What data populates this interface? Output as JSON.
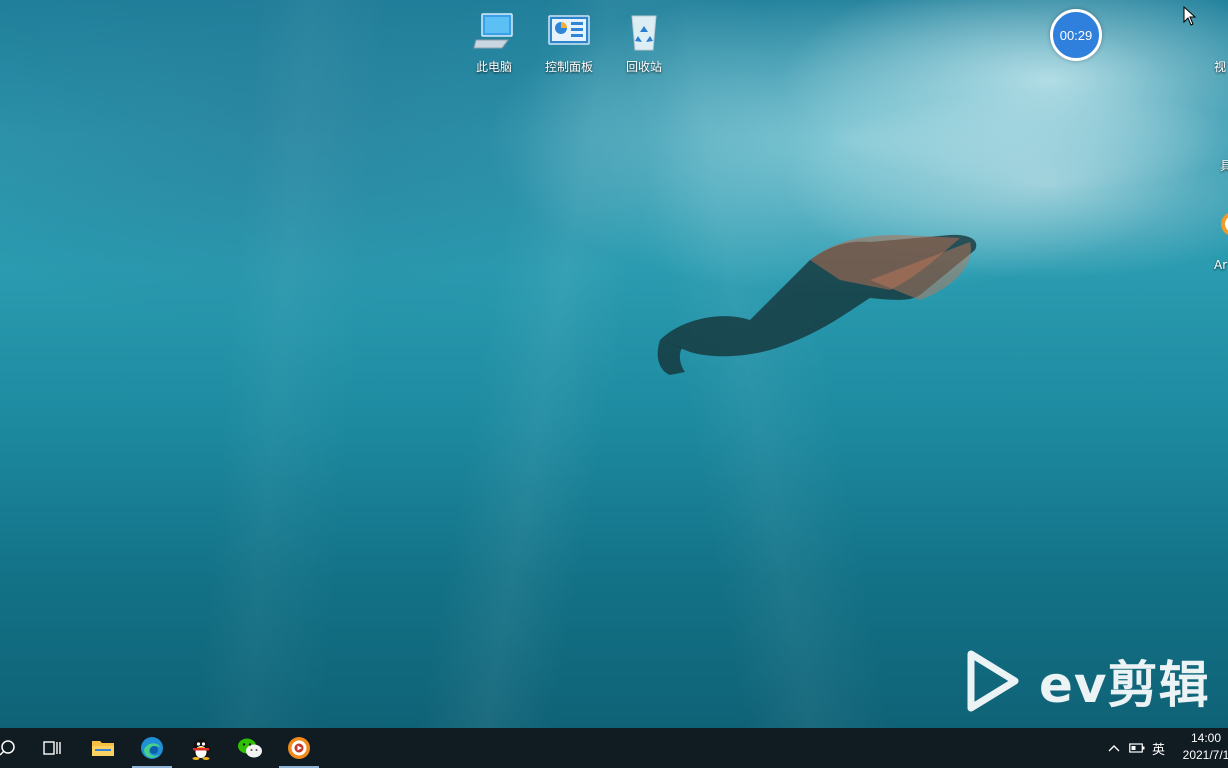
{
  "desktop": {
    "icons": [
      {
        "label": "此电脑",
        "icon": "computer-icon"
      },
      {
        "label": "控制面板",
        "icon": "control-panel-icon"
      },
      {
        "label": "回收站",
        "icon": "recycle-bin-icon"
      }
    ],
    "timer": "00:29",
    "edge_labels": {
      "top_right": "视",
      "middle_right": "具",
      "app_right": "Ar"
    },
    "watermark": "ev剪辑"
  },
  "taskbar": {
    "apps": [
      {
        "name": "search",
        "icon": "search-icon"
      },
      {
        "name": "task-view",
        "icon": "task-view-icon"
      },
      {
        "name": "file-explorer",
        "icon": "folder-icon"
      },
      {
        "name": "edge",
        "icon": "edge-browser-icon"
      },
      {
        "name": "qq",
        "icon": "qq-penguin-icon"
      },
      {
        "name": "wechat",
        "icon": "wechat-icon"
      },
      {
        "name": "ev-recorder",
        "icon": "ev-recorder-icon"
      }
    ],
    "tray": {
      "ime": "英"
    },
    "clock": {
      "time": "14:00",
      "date": "2021/7/1"
    }
  },
  "colors": {
    "taskbar": "#101b22",
    "timer": "#2f7fdc",
    "water": "#2a9bb0"
  }
}
